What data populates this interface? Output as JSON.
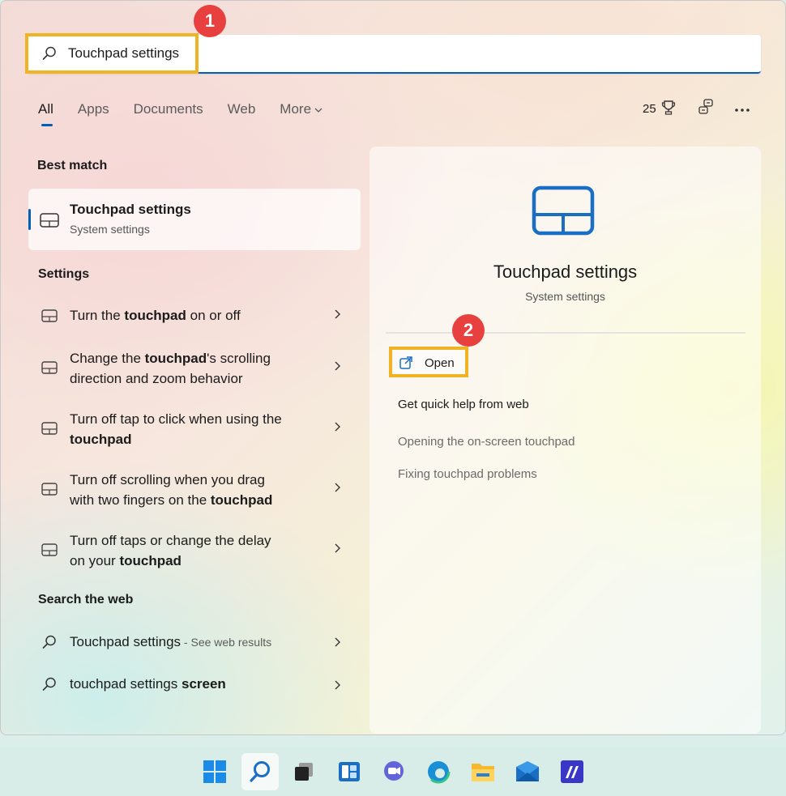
{
  "search": {
    "query": "Touchpad settings"
  },
  "annotations": {
    "badge1": "1",
    "badge2": "2",
    "highlight_color": "#f0b323",
    "badge_color": "#e8403f"
  },
  "tabs": [
    {
      "label": "All",
      "active": true
    },
    {
      "label": "Apps"
    },
    {
      "label": "Documents"
    },
    {
      "label": "Web"
    },
    {
      "label": "More"
    }
  ],
  "top_right": {
    "points": "25",
    "icons": [
      "trophy-icon",
      "network-icon",
      "more-options-icon"
    ]
  },
  "left": {
    "best_match_label": "Best match",
    "best_match": {
      "title": "Touchpad settings",
      "subtitle": "System settings",
      "icon": "touchpad-icon"
    },
    "settings_label": "Settings",
    "settings_items": [
      {
        "pre": "Turn the ",
        "bold": "touchpad",
        "post": " on or off",
        "line2_pre": "",
        "line2_bold": "",
        "line2_post": ""
      },
      {
        "pre": "Change the ",
        "bold": "touchpad",
        "post": "'s scrolling",
        "line2_pre": "direction and zoom behavior",
        "line2_bold": "",
        "line2_post": ""
      },
      {
        "pre": "Turn off tap to click when using the",
        "bold": "",
        "post": "",
        "line2_pre": "",
        "line2_bold": "touchpad",
        "line2_post": ""
      },
      {
        "pre": "Turn off scrolling when you drag",
        "bold": "",
        "post": "",
        "line2_pre": "with two fingers on the ",
        "line2_bold": "touchpad",
        "line2_post": ""
      },
      {
        "pre": "Turn off taps or change the delay",
        "bold": "",
        "post": "",
        "line2_pre": "on your ",
        "line2_bold": "touchpad",
        "line2_post": ""
      }
    ],
    "web_label": "Search the web",
    "web_items": [
      {
        "text": "Touchpad settings",
        "suffix": " - See web results",
        "bold": ""
      },
      {
        "text": "touchpad settings ",
        "suffix": "",
        "bold": "screen"
      }
    ]
  },
  "detail": {
    "title": "Touchpad settings",
    "subtitle": "System settings",
    "open_label": "Open",
    "help_heading": "Get quick help from web",
    "help_links": [
      "Opening the on-screen touchpad",
      "Fixing touchpad problems"
    ]
  },
  "taskbar": {
    "items": [
      "windows-start-icon",
      "search-icon",
      "task-view-icon",
      "widgets-icon",
      "teams-chat-icon",
      "edge-icon",
      "file-explorer-icon",
      "mail-icon",
      "app-icon"
    ]
  }
}
